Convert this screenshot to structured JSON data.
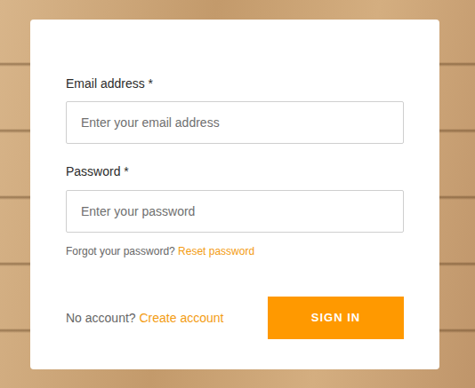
{
  "fields": [
    {
      "label": "Email address *",
      "placeholder": "Enter your email address"
    },
    {
      "label": "Password *",
      "placeholder": "Enter your password"
    }
  ],
  "forgot": {
    "text": "Forgot your password?",
    "link": "Reset password"
  },
  "signup": {
    "text": "No account?",
    "link": "Create account"
  },
  "buttons": [
    "SIGN IN"
  ]
}
